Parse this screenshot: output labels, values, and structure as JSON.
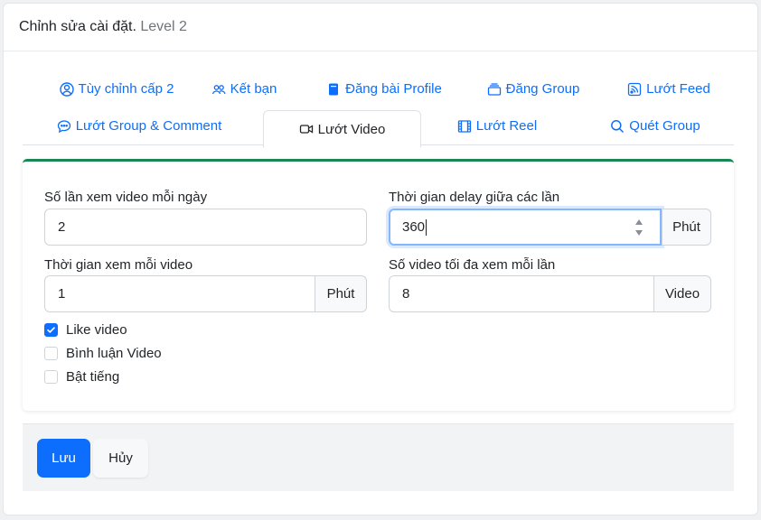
{
  "header": {
    "title": "Chỉnh sửa cài đặt.",
    "level": "Level 2"
  },
  "tabs": [
    {
      "label": "Tùy chỉnh cấp 2",
      "icon": "user-circle-icon"
    },
    {
      "label": "Kết bạn",
      "icon": "people-icon"
    },
    {
      "label": "Đăng bài Profile",
      "icon": "file-icon"
    },
    {
      "label": "Đăng Group",
      "icon": "collection-icon"
    },
    {
      "label": "Lướt Feed",
      "icon": "rss-icon"
    },
    {
      "label": "Lướt Group & Comment",
      "icon": "chat-icon"
    },
    {
      "label": "Lướt Video",
      "icon": "camera-video-icon",
      "active": true
    },
    {
      "label": "Lướt Reel",
      "icon": "film-icon"
    },
    {
      "label": "Quét Group",
      "icon": "search-icon"
    }
  ],
  "form": {
    "views_per_day": {
      "label": "Số lần xem video mỗi ngày",
      "value": "2"
    },
    "delay": {
      "label": "Thời gian delay giữa các lần",
      "value": "360",
      "unit": "Phút"
    },
    "watch_time": {
      "label": "Thời gian xem mỗi video",
      "value": "1",
      "unit": "Phút"
    },
    "max_videos": {
      "label": "Số video tối đa xem mỗi lần",
      "value": "8",
      "unit": "Video"
    },
    "checkboxes": [
      {
        "label": "Like video",
        "checked": true
      },
      {
        "label": "Bình luận Video",
        "checked": false
      },
      {
        "label": "Bật tiếng",
        "checked": false
      }
    ]
  },
  "footer": {
    "save_label": "Lưu",
    "cancel_label": "Hủy"
  },
  "colors": {
    "primary": "#0d6efd",
    "accent_border": "#198754"
  }
}
